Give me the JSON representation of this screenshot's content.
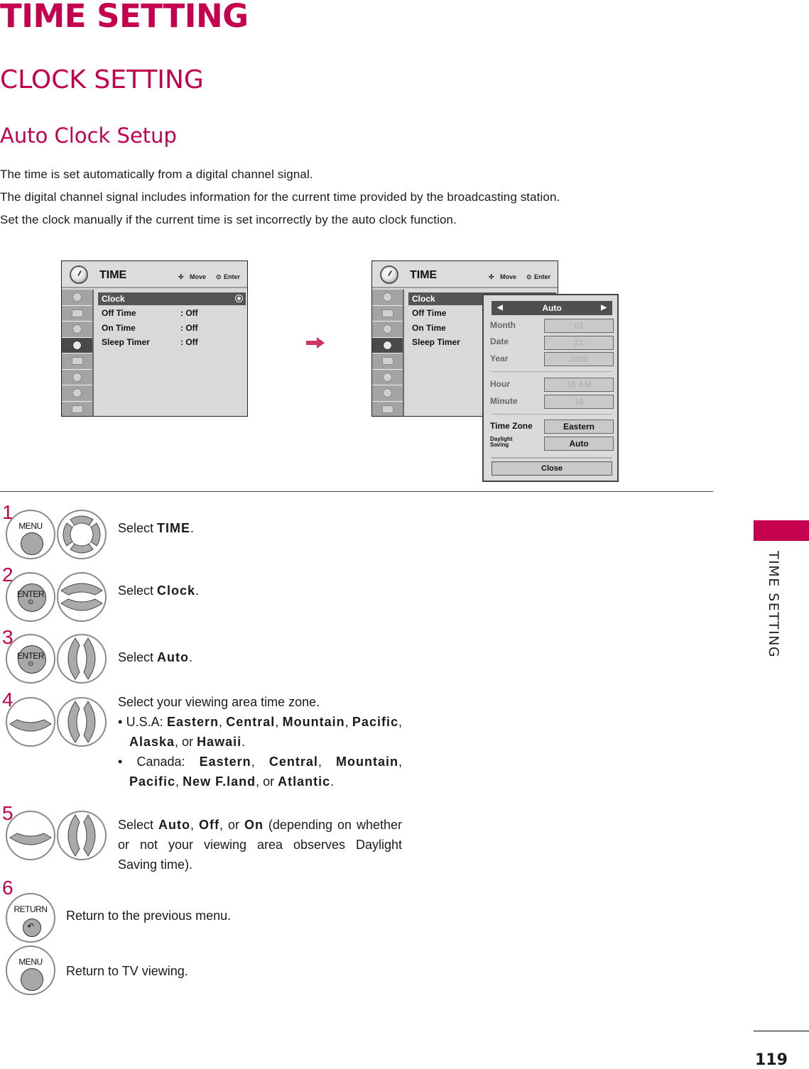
{
  "page": {
    "title": "TIME SETTING",
    "section": "CLOCK SETTING",
    "subsection": "Auto Clock Setup",
    "intro": [
      "The time is set automatically from a digital channel signal.",
      "The digital channel signal includes information for the current time provided by the broadcasting station.",
      "Set the clock manually if the current time is set incorrectly by the auto clock function."
    ],
    "side_tab": "TIME SETTING",
    "page_number": "119",
    "accent_color": "#c4004f"
  },
  "osd": {
    "title": "TIME",
    "hint_move": "Move",
    "hint_enter": "Enter",
    "menu_items": [
      {
        "label": "Clock",
        "value": ""
      },
      {
        "label": "Off Time",
        "value": ": Off"
      },
      {
        "label": "On Time",
        "value": ": Off"
      },
      {
        "label": "Sleep Timer",
        "value": ": Off"
      }
    ],
    "side_icons": [
      "channel-icon",
      "picture-icon",
      "audio-icon",
      "time-icon",
      "option-icon",
      "lock-icon",
      "usb-icon",
      "input-icon"
    ]
  },
  "popup": {
    "mode": "Auto",
    "fields": [
      {
        "label": "Month",
        "value": "02"
      },
      {
        "label": "Date",
        "value": "21"
      },
      {
        "label": "Year",
        "value": "2009"
      },
      {
        "label": "Hour",
        "value": "10 AM"
      },
      {
        "label": "Minute",
        "value": "10"
      },
      {
        "label": "Time Zone",
        "value": "Eastern"
      },
      {
        "label": "Daylight Saving",
        "value": "Auto"
      }
    ],
    "dst_line1": "Daylight",
    "dst_line2": "Saving",
    "close_label": "Close"
  },
  "steps": [
    {
      "num": "1",
      "prefix": "Select ",
      "bold": "TIME",
      "suffix": ".",
      "button": "MENU"
    },
    {
      "num": "2",
      "prefix": "Select ",
      "bold": "Clock",
      "suffix": ".",
      "button": "ENTER"
    },
    {
      "num": "3",
      "prefix": "Select ",
      "bold": "Auto",
      "suffix": ".",
      "button": "ENTER"
    },
    {
      "num": "4",
      "text": "Select your viewing area time zone.",
      "usa_label": "• U.S.A: ",
      "usa": [
        "Eastern",
        "Central",
        "Mountain",
        "Pacific",
        "Alaska",
        "Hawaii"
      ],
      "canada_label": "• Canada: ",
      "canada": [
        "Eastern",
        "Central",
        "Mountain",
        "Pacific",
        "New F.land",
        "Atlantic"
      ]
    },
    {
      "num": "5",
      "prefix": "Select ",
      "options": [
        "Auto",
        "Off",
        "On"
      ],
      "suffix": " (depending on whether or not your viewing area observes Daylight Saving time)."
    },
    {
      "num": "6",
      "text": "Return to the previous menu.",
      "button": "RETURN"
    },
    {
      "text": "Return to TV viewing.",
      "button": "MENU"
    }
  ],
  "words": {
    "comma": ", ",
    "or": ", or ",
    "period": "."
  }
}
